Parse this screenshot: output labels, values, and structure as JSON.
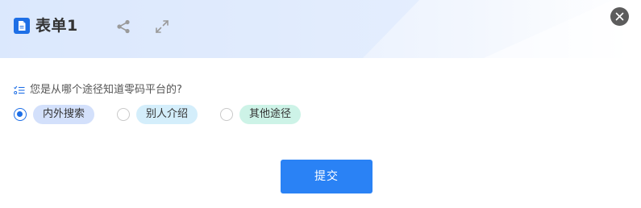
{
  "header": {
    "title": "表单1",
    "form_icon": "document-icon",
    "share_icon": "share-icon",
    "expand_icon": "expand-icon",
    "close_icon": "close-icon",
    "accent_color": "#2a82f5"
  },
  "question": {
    "icon": "checklist-icon",
    "text": "您是从哪个途径知道零码平台的?"
  },
  "options": [
    {
      "label": "内外搜索",
      "checked": true,
      "color": "#d3e0fb"
    },
    {
      "label": "别人介绍",
      "checked": false,
      "color": "#d4eefb"
    },
    {
      "label": "其他途径",
      "checked": false,
      "color": "#cdf3e7"
    }
  ],
  "submit": {
    "label": "提交"
  }
}
